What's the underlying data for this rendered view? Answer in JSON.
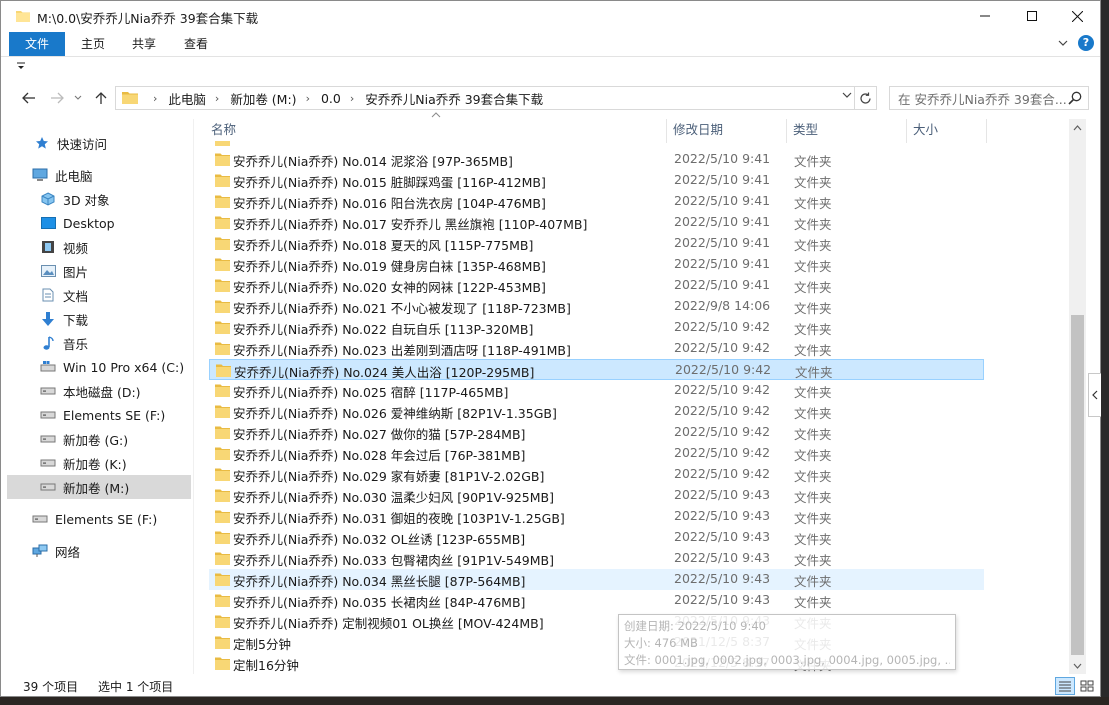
{
  "window": {
    "title": "M:\\0.0\\安乔乔儿Nia乔乔 39套合集下载"
  },
  "ribbon": {
    "tabs": [
      "文件",
      "主页",
      "共享",
      "查看"
    ]
  },
  "address": {
    "crumbs": [
      "此电脑",
      "新加卷 (M:)",
      "0.0",
      "安乔乔儿Nia乔乔 39套合集下载"
    ],
    "search_placeholder": "在 安乔乔儿Nia乔乔 39套合..."
  },
  "nav": {
    "items": [
      {
        "label": "快速访问",
        "icon": "star-icon"
      },
      {
        "label": "此电脑",
        "icon": "computer-icon"
      },
      {
        "label": "3D 对象",
        "icon": "cube-icon"
      },
      {
        "label": "Desktop",
        "icon": "desktop-icon"
      },
      {
        "label": "视频",
        "icon": "video-icon"
      },
      {
        "label": "图片",
        "icon": "picture-icon"
      },
      {
        "label": "文档",
        "icon": "document-icon"
      },
      {
        "label": "下载",
        "icon": "download-icon"
      },
      {
        "label": "音乐",
        "icon": "music-icon"
      },
      {
        "label": "Win 10 Pro x64 (C:)",
        "icon": "windows-drive-icon"
      },
      {
        "label": "本地磁盘 (D:)",
        "icon": "drive-icon"
      },
      {
        "label": "Elements SE (F:)",
        "icon": "drive-icon"
      },
      {
        "label": "新加卷 (G:)",
        "icon": "drive-icon"
      },
      {
        "label": "新加卷 (K:)",
        "icon": "drive-icon"
      },
      {
        "label": "新加卷 (M:)",
        "icon": "drive-icon"
      },
      {
        "label": "Elements SE (F:)",
        "icon": "drive-icon"
      },
      {
        "label": "网络",
        "icon": "network-icon"
      }
    ]
  },
  "columns": {
    "name": "名称",
    "date": "修改日期",
    "type": "类型",
    "size": "大小"
  },
  "files": [
    {
      "name": "安乔乔儿(Nia乔乔) No.014 泥浆浴 [97P-365MB]",
      "date": "2022/5/10 9:41",
      "type": "文件夹"
    },
    {
      "name": "安乔乔儿(Nia乔乔) No.015 脏脚踩鸡蛋 [116P-412MB]",
      "date": "2022/5/10 9:41",
      "type": "文件夹"
    },
    {
      "name": "安乔乔儿(Nia乔乔) No.016 阳台洗衣房 [104P-476MB]",
      "date": "2022/5/10 9:41",
      "type": "文件夹"
    },
    {
      "name": "安乔乔儿(Nia乔乔) No.017 安乔乔儿 黑丝旗袍 [110P-407MB]",
      "date": "2022/5/10 9:41",
      "type": "文件夹"
    },
    {
      "name": "安乔乔儿(Nia乔乔) No.018 夏天的风 [115P-775MB]",
      "date": "2022/5/10 9:41",
      "type": "文件夹"
    },
    {
      "name": "安乔乔儿(Nia乔乔) No.019 健身房白袜 [135P-468MB]",
      "date": "2022/5/10 9:41",
      "type": "文件夹"
    },
    {
      "name": "安乔乔儿(Nia乔乔) No.020 女神的网袜 [122P-453MB]",
      "date": "2022/5/10 9:41",
      "type": "文件夹"
    },
    {
      "name": "安乔乔儿(Nia乔乔) No.021 不小心被发现了 [118P-723MB]",
      "date": "2022/9/8 14:06",
      "type": "文件夹"
    },
    {
      "name": "安乔乔儿(Nia乔乔) No.022 自玩自乐 [113P-320MB]",
      "date": "2022/5/10 9:42",
      "type": "文件夹"
    },
    {
      "name": "安乔乔儿(Nia乔乔) No.023 出差刚到酒店呀 [118P-491MB]",
      "date": "2022/5/10 9:42",
      "type": "文件夹"
    },
    {
      "name": "安乔乔儿(Nia乔乔) No.024 美人出浴 [120P-295MB]",
      "date": "2022/5/10 9:42",
      "type": "文件夹"
    },
    {
      "name": "安乔乔儿(Nia乔乔) No.025 宿醉 [117P-465MB]",
      "date": "2022/5/10 9:42",
      "type": "文件夹"
    },
    {
      "name": "安乔乔儿(Nia乔乔) No.026 爱神维纳斯 [82P1V-1.35GB]",
      "date": "2022/5/10 9:42",
      "type": "文件夹"
    },
    {
      "name": "安乔乔儿(Nia乔乔) No.027 做你的猫 [57P-284MB]",
      "date": "2022/5/10 9:42",
      "type": "文件夹"
    },
    {
      "name": "安乔乔儿(Nia乔乔) No.028 年会过后 [76P-381MB]",
      "date": "2022/5/10 9:42",
      "type": "文件夹"
    },
    {
      "name": "安乔乔儿(Nia乔乔) No.029 家有娇妻 [81P1V-2.02GB]",
      "date": "2022/5/10 9:42",
      "type": "文件夹"
    },
    {
      "name": "安乔乔儿(Nia乔乔) No.030 温柔少妇风 [90P1V-925MB]",
      "date": "2022/5/10 9:43",
      "type": "文件夹"
    },
    {
      "name": "安乔乔儿(Nia乔乔) No.031 御姐的夜晚 [103P1V-1.25GB]",
      "date": "2022/5/10 9:43",
      "type": "文件夹"
    },
    {
      "name": "安乔乔儿(Nia乔乔) No.032 OL丝诱 [123P-655MB]",
      "date": "2022/5/10 9:43",
      "type": "文件夹"
    },
    {
      "name": "安乔乔儿(Nia乔乔) No.033 包臀裙肉丝 [91P1V-549MB]",
      "date": "2022/5/10 9:43",
      "type": "文件夹"
    },
    {
      "name": "安乔乔儿(Nia乔乔) No.034 黑丝长腿 [87P-564MB]",
      "date": "2022/5/10 9:43",
      "type": "文件夹"
    },
    {
      "name": "安乔乔儿(Nia乔乔) No.035 长裙肉丝 [84P-476MB]",
      "date": "2022/5/10 9:43",
      "type": "文件夹"
    },
    {
      "name": "安乔乔儿(Nia乔乔) 定制视频01 OL换丝 [MOV-424MB]",
      "date": "2022/5/10 9:43",
      "type": "文件夹"
    },
    {
      "name": "定制5分钟",
      "date": "2021/12/5 8:37",
      "type": "文件夹"
    },
    {
      "name": "定制16分钟",
      "date": "2021/12/5 8:37",
      "type": "文件夹"
    }
  ],
  "tooltip": {
    "line1": "创建日期: 2022/5/10 9:40",
    "line2": "大小: 476 MB",
    "line3": "文件: 0001.jpg, 0002.jpg, 0003.jpg, 0004.jpg, 0005.jpg, ..."
  },
  "status": {
    "count": "39 个项目",
    "selected": "选中 1 个项目"
  },
  "colors": {
    "accent": "#1979ca",
    "selection": "#cce8ff",
    "folder": "#f8d775"
  }
}
